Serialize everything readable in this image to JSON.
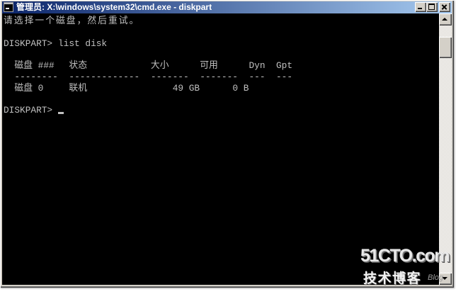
{
  "window": {
    "title": "管理员: X:\\windows\\system32\\cmd.exe - diskpart",
    "title_icon": "cmd-icon",
    "controls": {
      "minimize": "minimize-icon",
      "maximize": "maximize-icon",
      "close": "close-icon"
    }
  },
  "console": {
    "lines": {
      "message": "请选择一个磁盘，然后重试。",
      "prompt": "DISKPART>",
      "command": "list disk",
      "prompt_current": "DISKPART>"
    },
    "table": {
      "headers": [
        "磁盘 ###",
        "状态",
        "大小",
        "可用",
        "Dyn",
        "Gpt"
      ],
      "separators": [
        "--------",
        "-------------",
        "-------",
        "-------",
        "---",
        "---"
      ],
      "rows": [
        [
          "磁盘 0",
          "联机",
          "49 GB",
          "0 B"
        ]
      ]
    }
  },
  "scrollbar": {
    "up_icon": "scroll-up-icon",
    "down_icon": "scroll-down-icon",
    "position": 0.05,
    "visible": 0.086
  },
  "watermark": {
    "site": "51CTO.com",
    "name": "技术博客",
    "tag": "Blog"
  },
  "theme": {
    "console_bg": "#000000",
    "console_fg": "#c0c0c0",
    "title_start": "#0a246a",
    "title_end": "#a6caf0",
    "frame": "#d4d0c8"
  }
}
